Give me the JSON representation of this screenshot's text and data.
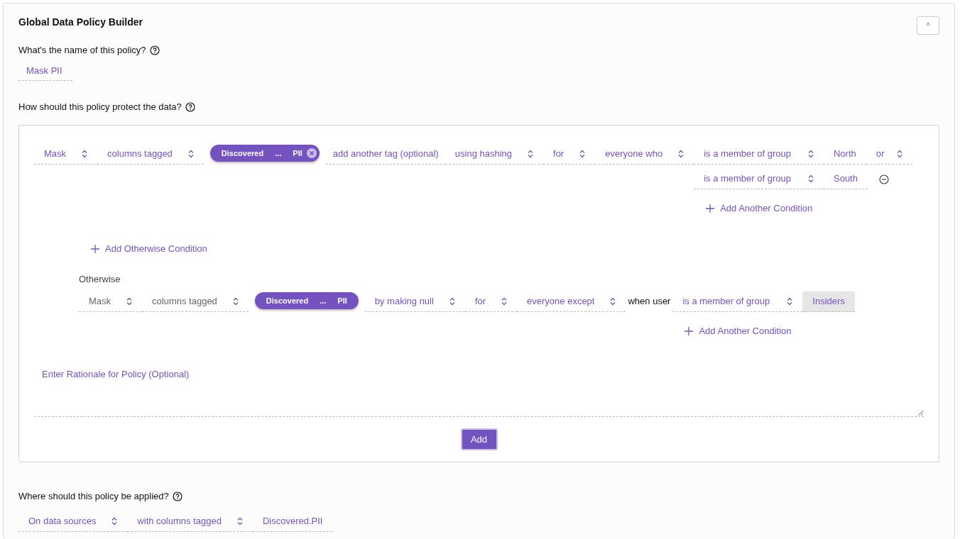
{
  "title": "Global Data Policy Builder",
  "collapse_button": {
    "icon": "^"
  },
  "name_question": "What's the name of this policy?",
  "name_value": "Mask PII",
  "protect_question": "How should this policy protect the data?",
  "rule": {
    "fields": [
      {
        "kind": "select",
        "value": "Mask",
        "disabled": false
      },
      {
        "kind": "select",
        "value": "columns tagged",
        "disabled": false
      },
      {
        "kind": "tag",
        "parts": [
          "Discovered",
          "...",
          "PII"
        ],
        "removable": true
      },
      {
        "kind": "input",
        "placeholder": "add another tag (optional)"
      },
      {
        "kind": "select",
        "value": "using hashing",
        "disabled": false
      },
      {
        "kind": "select",
        "value": "for",
        "disabled": false
      },
      {
        "kind": "select",
        "value": "everyone who",
        "disabled": false
      }
    ],
    "conditions": [
      {
        "operator": "is a member of group",
        "group": "North",
        "focused": false,
        "end": {
          "kind": "select",
          "value": "or"
        }
      },
      {
        "operator": "is a member of group",
        "group": "South",
        "focused": false,
        "end": {
          "kind": "remove"
        }
      }
    ],
    "add_condition": "Add Another Condition"
  },
  "add_otherwise": "Add Otherwise Condition",
  "otherwise": {
    "label": "Otherwise",
    "fields": [
      {
        "kind": "select",
        "value": "Mask",
        "disabled": true
      },
      {
        "kind": "select",
        "value": "columns tagged",
        "disabled": true
      },
      {
        "kind": "tag",
        "parts": [
          "Discovered",
          "...",
          "PII"
        ],
        "removable": false
      },
      {
        "kind": "select",
        "value": "by making null",
        "disabled": false
      },
      {
        "kind": "select",
        "value": "for",
        "disabled": false
      },
      {
        "kind": "select",
        "value": "everyone except",
        "disabled": false
      },
      {
        "kind": "text",
        "value": "when user"
      }
    ],
    "conditions": [
      {
        "operator": "is a member of group",
        "group": "Insiders",
        "focused": true
      }
    ],
    "add_condition": "Add Another Condition"
  },
  "rationale": {
    "placeholder": "Enter Rationale for Policy (Optional)"
  },
  "add_button": "Add",
  "apply_question": "Where should this policy be applied?",
  "apply": [
    {
      "kind": "select",
      "value": "On data sources",
      "disabled": false
    },
    {
      "kind": "select",
      "value": "with columns tagged",
      "disabled": false
    },
    {
      "kind": "value",
      "value": "Discovered.PII"
    }
  ]
}
